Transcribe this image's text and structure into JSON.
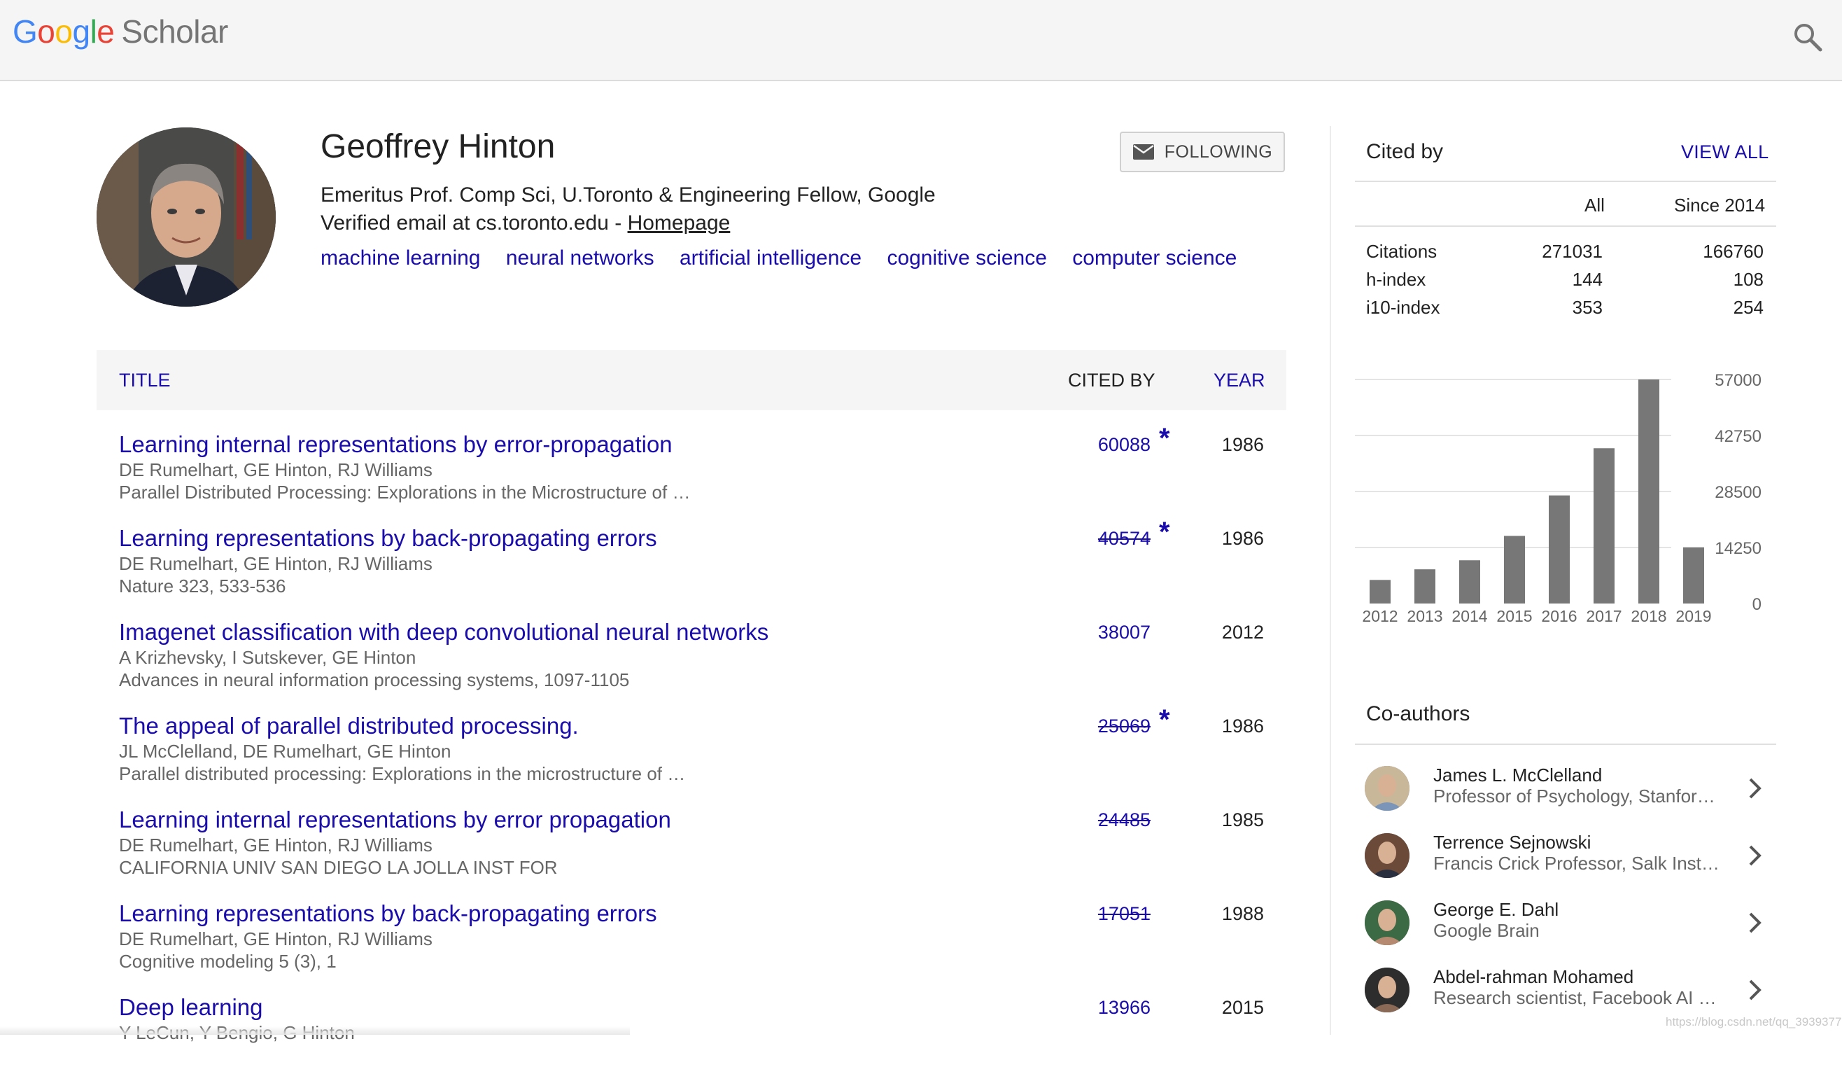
{
  "header": {
    "logo_google": "Google",
    "logo_scholar": "Scholar",
    "search_icon": "search-icon"
  },
  "profile": {
    "name": "Geoffrey Hinton",
    "affiliation": "Emeritus Prof. Comp Sci, U.Toronto & Engineering Fellow, Google",
    "email_text": "Verified email at cs.toronto.edu - ",
    "homepage_label": "Homepage",
    "follow_label": "FOLLOWING",
    "interests": [
      "machine learning",
      "neural networks",
      "artificial intelligence",
      "cognitive science",
      "computer science"
    ]
  },
  "table": {
    "headers": {
      "title": "TITLE",
      "cited_by": "CITED BY",
      "year": "YEAR"
    },
    "rows": [
      {
        "title": "Learning internal representations by error-propagation",
        "authors": "DE Rumelhart, GE Hinton, RJ Williams",
        "venue": "Parallel Distributed Processing: Explorations in the Microstructure of …",
        "cited": "60088",
        "star": "*",
        "year": "1986",
        "struck": false
      },
      {
        "title": "Learning representations by back-propagating errors",
        "authors": "DE Rumelhart, GE Hinton, RJ Williams",
        "venue": "Nature 323, 533-536",
        "cited": "40574",
        "star": "*",
        "year": "1986",
        "struck": true
      },
      {
        "title": "Imagenet classification with deep convolutional neural networks",
        "authors": "A Krizhevsky, I Sutskever, GE Hinton",
        "venue": "Advances in neural information processing systems, 1097-1105",
        "cited": "38007",
        "star": "",
        "year": "2012",
        "struck": false
      },
      {
        "title": "The appeal of parallel distributed processing.",
        "authors": "JL McClelland, DE Rumelhart, GE Hinton",
        "venue": "Parallel distributed processing: Explorations in the microstructure of …",
        "cited": "25069",
        "star": "*",
        "year": "1986",
        "struck": true
      },
      {
        "title": "Learning internal representations by error propagation",
        "authors": "DE Rumelhart, GE Hinton, RJ Williams",
        "venue": "CALIFORNIA UNIV SAN DIEGO LA JOLLA INST FOR",
        "cited": "24485",
        "star": "",
        "year": "1985",
        "struck": true
      },
      {
        "title": "Learning representations by back-propagating errors",
        "authors": "DE Rumelhart, GE Hinton, RJ Williams",
        "venue": "Cognitive modeling 5 (3), 1",
        "cited": "17051",
        "star": "",
        "year": "1988",
        "struck": true
      },
      {
        "title": "Deep learning",
        "authors": "Y LeCun, Y Bengio, G Hinton",
        "venue": "",
        "cited": "13966",
        "star": "",
        "year": "2015",
        "struck": false
      }
    ]
  },
  "cited_by": {
    "title": "Cited by",
    "view_all": "VIEW ALL",
    "col_all": "All",
    "col_since": "Since 2014",
    "stats": [
      {
        "label": "Citations",
        "all": "271031",
        "since": "166760"
      },
      {
        "label": "h-index",
        "all": "144",
        "since": "108"
      },
      {
        "label": "i10-index",
        "all": "353",
        "since": "254"
      }
    ]
  },
  "chart_data": {
    "type": "bar",
    "categories": [
      "2012",
      "2013",
      "2014",
      "2015",
      "2016",
      "2017",
      "2018",
      "2019"
    ],
    "values": [
      6000,
      8700,
      11000,
      17200,
      27500,
      39500,
      57000,
      14300
    ],
    "yticks": [
      "57000",
      "42750",
      "28500",
      "14250",
      "0"
    ],
    "ylim": [
      0,
      57000
    ],
    "bar_color": "#777777",
    "grid": true
  },
  "coauthors": {
    "title": "Co-authors",
    "items": [
      {
        "name": "James L. McClelland",
        "affiliation": "Professor of Psychology, Stanford University"
      },
      {
        "name": "Terrence Sejnowski",
        "affiliation": "Francis Crick Professor, Salk Institute"
      },
      {
        "name": "George E. Dahl",
        "affiliation": "Google Brain"
      },
      {
        "name": "Abdel-rahman Mohamed",
        "affiliation": "Research scientist, Facebook AI Research"
      }
    ]
  },
  "watermark": "https://blog.csdn.net/qq_39393773"
}
